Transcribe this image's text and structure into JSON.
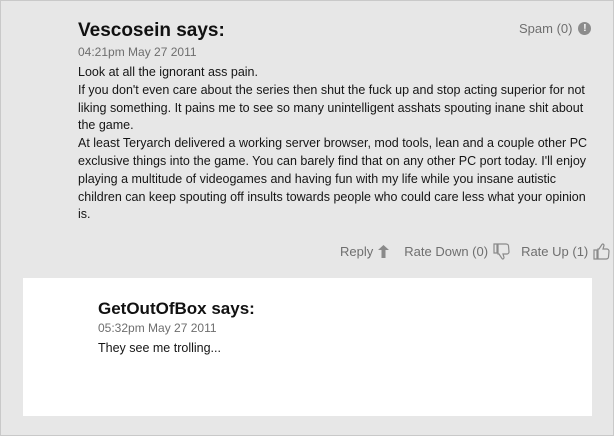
{
  "comment": {
    "author_line": "Vescosein says:",
    "timestamp": "04:21pm May 27 2011",
    "spam_label": "Spam (0)",
    "body_lines": [
      "Look at all the ignorant ass pain.",
      "If you don't even care about the series then shut the fuck up and stop acting superior for not liking something. It pains me to see so many unintelligent asshats spouting inane shit about the game.",
      "At least Teryarch delivered a working server browser, mod tools, lean and a couple other PC exclusive things into the game. You can barely find that on any other PC port today. I'll enjoy playing a multitude of videogames and having fun with my life while you insane autistic children can keep spouting off insults towards people who could care less what your opinion is."
    ],
    "actions": {
      "reply_label": "Reply",
      "rate_down_label": "Rate Down (0)",
      "rate_up_label": "Rate Up (1)"
    }
  },
  "reply": {
    "author_line": "GetOutOfBox says:",
    "timestamp": "05:32pm May 27 2011",
    "body": "They see me trolling..."
  },
  "icons": {
    "spam": "exclamation-circle-icon",
    "reply": "reply-arrow-icon",
    "rate_down": "thumbs-down-icon",
    "rate_up": "thumbs-up-icon"
  },
  "colors": {
    "panel_bg": "#e7e7e7",
    "reply_bg": "#ffffff",
    "muted_text": "#6f6f6f"
  }
}
